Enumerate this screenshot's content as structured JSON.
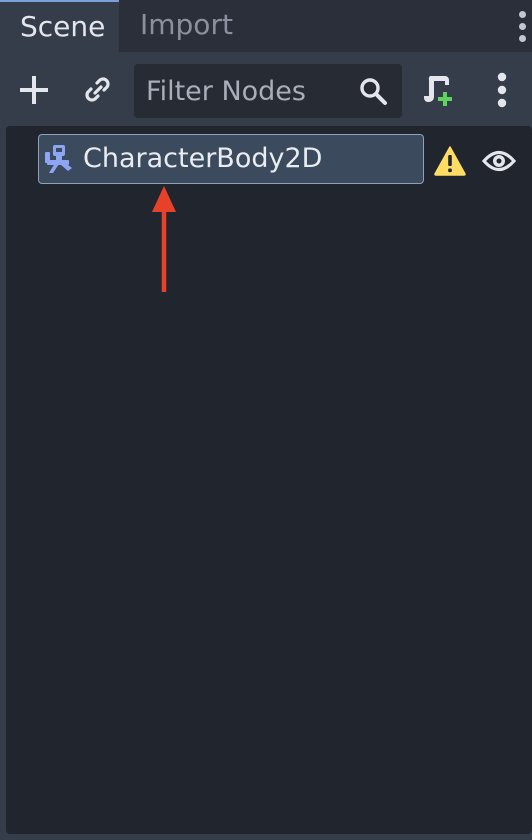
{
  "tabs": [
    {
      "label": "Scene",
      "active": true
    },
    {
      "label": "Import",
      "active": false
    }
  ],
  "toolbar": {
    "add_icon": "plus-icon",
    "link_icon": "link-icon",
    "filter_placeholder": "Filter Nodes",
    "search_icon": "search-icon",
    "script_icon": "attach-script-icon",
    "more_icon": "vertical-dots-icon"
  },
  "tree": {
    "nodes": [
      {
        "label": "CharacterBody2D",
        "icon": "character-body-2d-icon",
        "selected": true,
        "warning": true,
        "visible": true
      }
    ]
  },
  "annotation": {
    "arrow_color": "#e8412a"
  },
  "colors": {
    "accent": "#7aa0d6",
    "selection": "#3b4a5d",
    "node_icon": "#8da5f3",
    "warning": "#ffdd65",
    "script_add": "#5fd35f"
  }
}
